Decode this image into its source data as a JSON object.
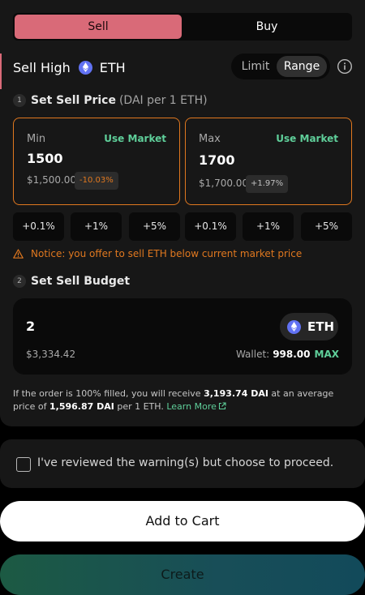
{
  "side_tabs": {
    "sell": "Sell",
    "buy": "Buy"
  },
  "header": {
    "prefix": "Sell High",
    "token": "ETH"
  },
  "mode": {
    "limit": "Limit",
    "range": "Range",
    "selected": "Range"
  },
  "step1": {
    "num": "1",
    "label": "Set Sell Price",
    "sub": "(DAI per 1 ETH)"
  },
  "min_card": {
    "label": "Min",
    "use_market": "Use Market",
    "price": "1500",
    "fiat": "$1,500.00",
    "pct": "-10.03%"
  },
  "max_card": {
    "label": "Max",
    "use_market": "Use Market",
    "price": "1700",
    "fiat": "$1,700.00",
    "pct": "+1.97%"
  },
  "adjust_buttons": [
    "+0.1%",
    "+1%",
    "+5%",
    "+0.1%",
    "+1%",
    "+5%"
  ],
  "notice": "Notice: you offer to sell ETH below current market price",
  "step2": {
    "num": "2",
    "label": "Set Sell Budget"
  },
  "budget": {
    "amount": "2",
    "token": "ETH",
    "fiat": "$3,334.42",
    "wallet_label": "Wallet:",
    "wallet_balance": "998.00",
    "max": "MAX"
  },
  "summary": {
    "t1": "If the order is 100% filled, you will receive ",
    "receive": "3,193.74 DAI",
    "t2": " at an average price of ",
    "avg": "1,596.87 DAI",
    "t3": " per 1 ETH. ",
    "learn_more": "Learn More"
  },
  "warning_check": {
    "label": "I've reviewed the warning(s) but choose to proceed.",
    "checked": false
  },
  "buttons": {
    "add_to_cart": "Add to Cart",
    "create": "Create"
  },
  "colors": {
    "sell_accent": "#d96a78",
    "warning_orange": "#e0781f",
    "market_green": "#5fcf9a",
    "eth_blue": "#6172f3"
  },
  "icons": {
    "token": "eth-icon",
    "info": "info-icon",
    "notice": "warning-triangle-icon",
    "learn_more": "external-link-icon"
  }
}
